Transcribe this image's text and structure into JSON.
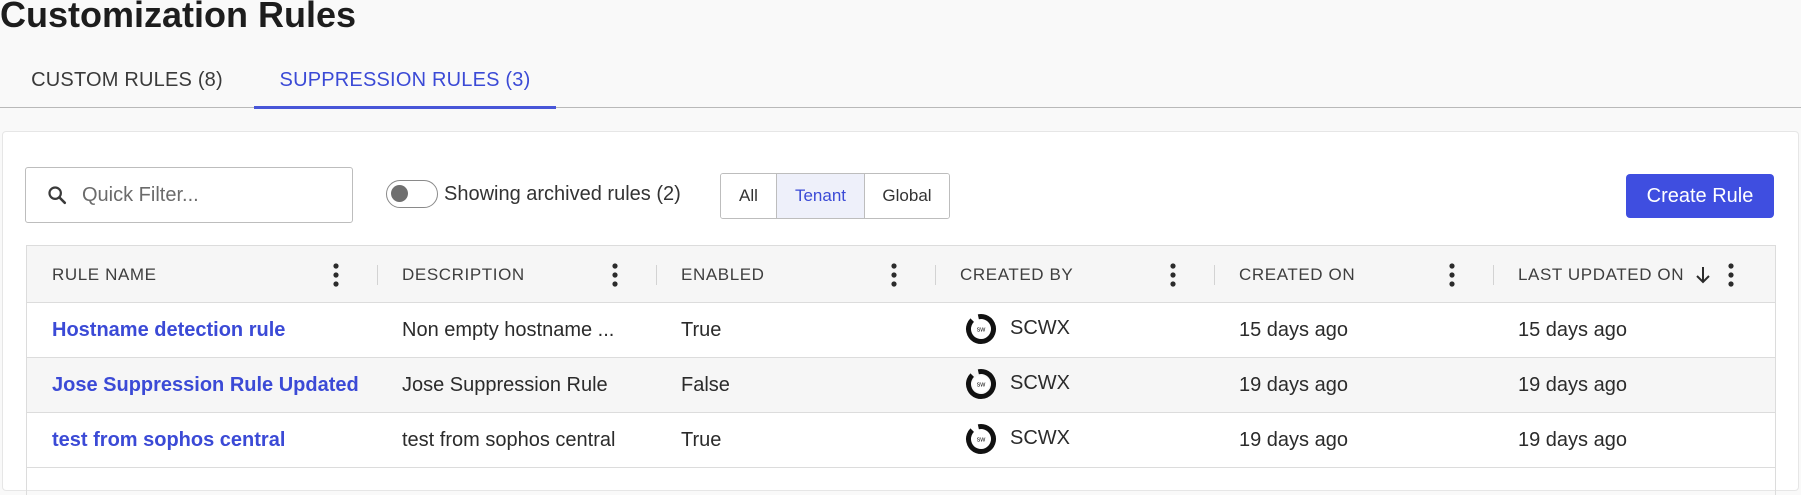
{
  "page": {
    "title": "Customization Rules"
  },
  "tabs": [
    {
      "label": "CUSTOM RULES (8)",
      "active": false
    },
    {
      "label": "SUPPRESSION RULES (3)",
      "active": true
    }
  ],
  "toolbar": {
    "search_placeholder": "Quick Filter...",
    "archived_toggle_label": "Showing archived rules (2)",
    "archived_toggle_on": false,
    "scope_filter": {
      "options": [
        "All",
        "Tenant",
        "Global"
      ],
      "selected": "Tenant"
    },
    "create_button_label": "Create Rule"
  },
  "grid": {
    "columns": [
      "RULE NAME",
      "DESCRIPTION",
      "ENABLED",
      "CREATED BY",
      "CREATED ON",
      "LAST UPDATED ON"
    ],
    "sort": {
      "column": "LAST UPDATED ON",
      "direction": "desc"
    },
    "rows": [
      {
        "rule_name": "Hostname detection rule",
        "description": "Non empty hostname ...",
        "enabled": "True",
        "created_by": "SCWX",
        "created_on": "15 days ago",
        "last_updated_on": "15 days ago"
      },
      {
        "rule_name": "Jose Suppression Rule Updated",
        "description": "Jose Suppression Rule",
        "enabled": "False",
        "created_by": "SCWX",
        "created_on": "19 days ago",
        "last_updated_on": "19 days ago"
      },
      {
        "rule_name": "test from sophos central",
        "description": "test from sophos central",
        "enabled": "True",
        "created_by": "SCWX",
        "created_on": "19 days ago",
        "last_updated_on": "19 days ago"
      }
    ]
  },
  "icons": {
    "search": "search-icon",
    "column_menu": "kebab-menu-icon",
    "sort": "arrow-down-icon",
    "avatar": "secureworks-logo-icon"
  },
  "colors": {
    "accent": "#3f4ee0",
    "link": "#3b4ad6",
    "selected_segment_bg": "#eef0fa"
  }
}
